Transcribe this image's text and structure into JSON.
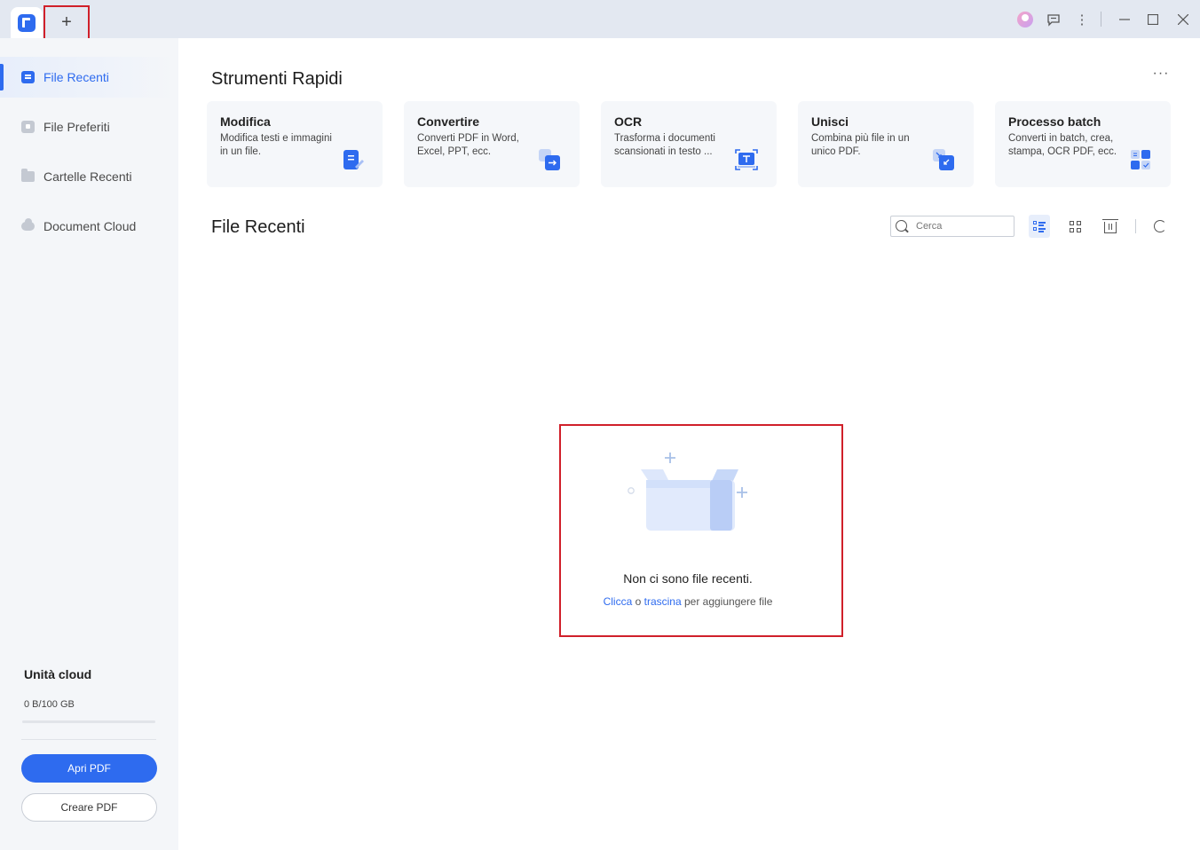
{
  "titlebar": {
    "new_tab_label": "+",
    "icons": [
      "user-avatar",
      "feedback-icon",
      "more-vertical-icon",
      "minimize-icon",
      "maximize-icon",
      "close-icon"
    ],
    "minimize_glyph": "—",
    "maximize_glyph": "☐",
    "close_glyph": "✕",
    "feedback_glyph": "▭",
    "kebab_glyph": "⋮"
  },
  "sidebar": {
    "items": [
      {
        "label": "File Recenti",
        "icon": "recent-file-icon",
        "active": true
      },
      {
        "label": "File Preferiti",
        "icon": "favorite-file-icon",
        "active": false
      },
      {
        "label": "Cartelle Recenti",
        "icon": "folder-icon",
        "active": false
      },
      {
        "label": "Document Cloud",
        "icon": "cloud-icon",
        "active": false
      }
    ],
    "cloud": {
      "title": "Unità cloud",
      "usage": "0 B/100 GB",
      "used_fraction": 0
    },
    "open_pdf_label": "Apri PDF",
    "create_pdf_label": "Creare PDF"
  },
  "quick_tools": {
    "title": "Strumenti Rapidi",
    "more_glyph": "···",
    "cards": [
      {
        "title": "Modifica",
        "desc": "Modifica testi e immagini in un file.",
        "icon": "edit-icon"
      },
      {
        "title": "Convertire",
        "desc": "Converti PDF in Word, Excel, PPT, ecc.",
        "icon": "convert-icon"
      },
      {
        "title": "OCR",
        "desc": "Trasforma i documenti scansionati in testo ...",
        "icon": "ocr-icon"
      },
      {
        "title": "Unisci",
        "desc": "Combina più file in un unico PDF.",
        "icon": "merge-icon"
      },
      {
        "title": "Processo batch",
        "desc": "Converti in batch, crea, stampa, OCR PDF, ecc.",
        "icon": "batch-icon"
      }
    ]
  },
  "recent_files": {
    "title": "File Recenti",
    "search_placeholder": "Cerca",
    "empty_title": "Non ci sono file recenti.",
    "empty_hint_click": "Clicca",
    "empty_hint_or": " o ",
    "empty_hint_drag": "trascina",
    "empty_hint_rest": " per aggiungere file"
  },
  "colors": {
    "accent": "#2e6bef",
    "highlight_box": "#d0202a",
    "sidebar_bg": "#f4f6f9",
    "titlebar_bg": "#e3e8f1"
  }
}
